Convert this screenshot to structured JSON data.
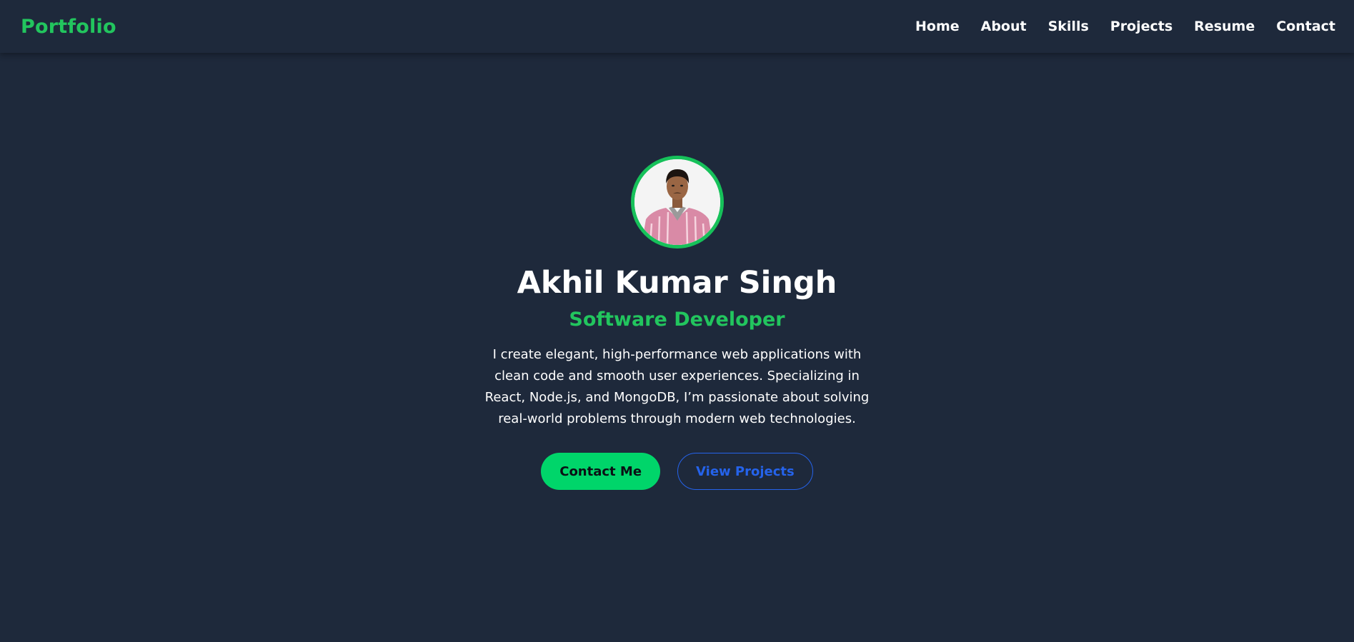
{
  "navbar": {
    "brand": "Portfolio",
    "links": [
      "Home",
      "About",
      "Skills",
      "Projects",
      "Resume",
      "Contact"
    ]
  },
  "hero": {
    "avatar_icon": "profile-photo",
    "name": "Akhil Kumar Singh",
    "role": "Software Developer",
    "bio": "I create elegant, high-performance web applications with clean code and smooth user experiences. Specializing in React, Node.js, and MongoDB, I’m passionate about solving real-world problems through modern web technologies.",
    "primary_button": "Contact Me",
    "secondary_button": "View Projects"
  },
  "colors": {
    "background": "#1e293b",
    "accent": "#22c55e",
    "primary_button": "#00d56a",
    "secondary_button": "#2563eb"
  }
}
